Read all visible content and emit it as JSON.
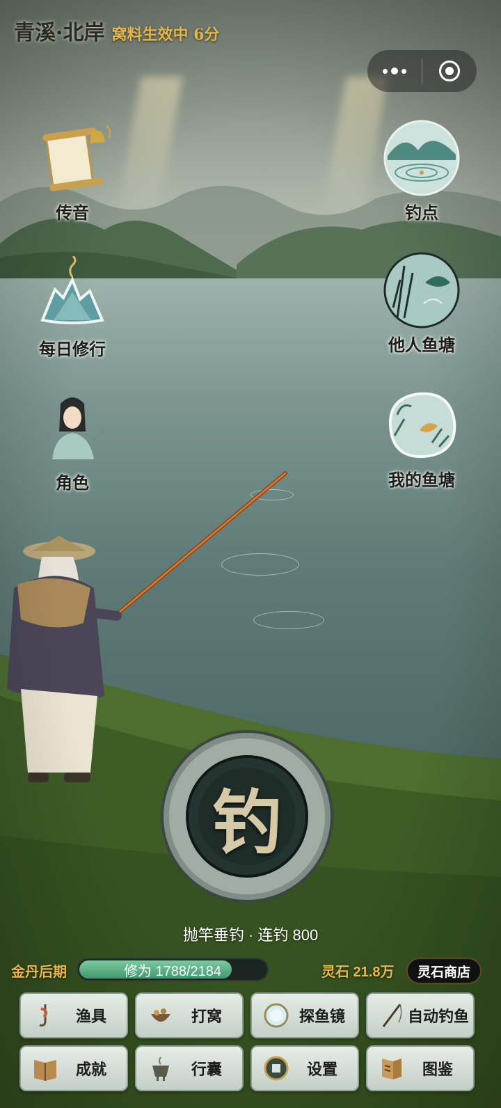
{
  "header": {
    "location": "青溪·北岸",
    "bait_status": "窝料生效中 6分"
  },
  "capsule": {
    "menu_icon": "more-dots-icon",
    "close_icon": "target-circle-icon"
  },
  "left_menu": [
    {
      "label": "传音",
      "icon": "scroll-bell-icon"
    },
    {
      "label": "每日修行",
      "icon": "incense-mountain-icon"
    },
    {
      "label": "角色",
      "icon": "cultivator-portrait-icon"
    }
  ],
  "right_menu": [
    {
      "label": "钓点",
      "icon": "landscape-ripple-icon"
    },
    {
      "label": "他人鱼塘",
      "icon": "reed-fish-icon"
    },
    {
      "label": "我的鱼塘",
      "icon": "koi-pond-icon"
    }
  ],
  "fish_button": {
    "char": "钓",
    "caption": "抛竿垂钓 · 连钓 800"
  },
  "status": {
    "realm": "金丹后期",
    "xp_text": "修为 1788/2184",
    "xp_fraction": 0.8187,
    "spirit_stone": "灵石 21.8万",
    "shop_label": "灵石商店"
  },
  "toolbar": [
    {
      "label": "渔具",
      "icon": "lure-hook-icon"
    },
    {
      "label": "打窝",
      "icon": "bait-bowl-icon"
    },
    {
      "label": "探鱼镜",
      "icon": "mirror-icon"
    },
    {
      "label": "自动钓鱼",
      "icon": "fishing-rod-icon"
    },
    {
      "label": "成就",
      "icon": "book-icon"
    },
    {
      "label": "行囊",
      "icon": "censer-icon"
    },
    {
      "label": "设置",
      "icon": "coin-gear-icon"
    },
    {
      "label": "图鉴",
      "icon": "codex-book-icon"
    }
  ],
  "colors": {
    "gold": "#e8b84a",
    "jade": "#3e9a6e",
    "lake": "#6a8581"
  }
}
